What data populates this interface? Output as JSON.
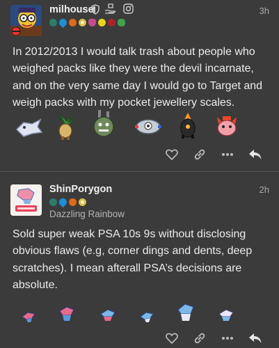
{
  "posts": [
    {
      "username": "milhouse",
      "time": "3h",
      "text": "In 2012/2013 I would talk trash about people who weighed packs like they were the devil incarnate, and on the very same day I would go to Target and weigh packs with my pocket jewellery scales.",
      "header_icons": [
        "shield-icon",
        "hand-gift-icon",
        "instagram-icon"
      ],
      "badges": [
        "#2e7d6a",
        "#1e8fd6",
        "#e06a1a",
        "#d9c04a",
        "#c54b8c",
        "#e7d51b",
        "#b0202a",
        "#3ca24b"
      ]
    },
    {
      "username": "ShinPorygon",
      "time": "2h",
      "title": "Dazzling Rainbow",
      "text": "Sold super weak PSA 10s 9s without disclosing obvious flaws (e.g, corner dings and dents, deep scratches). I mean afterall PSA’s decisions are absolute.",
      "badges": [
        "#2e7d6a",
        "#1e8fd6",
        "#e06a1a",
        "#d9c04a"
      ]
    }
  ],
  "colors": {
    "background": "#3b3b3b",
    "text": "#ececec",
    "muted": "#a9a9a9",
    "divider": "#555555"
  }
}
